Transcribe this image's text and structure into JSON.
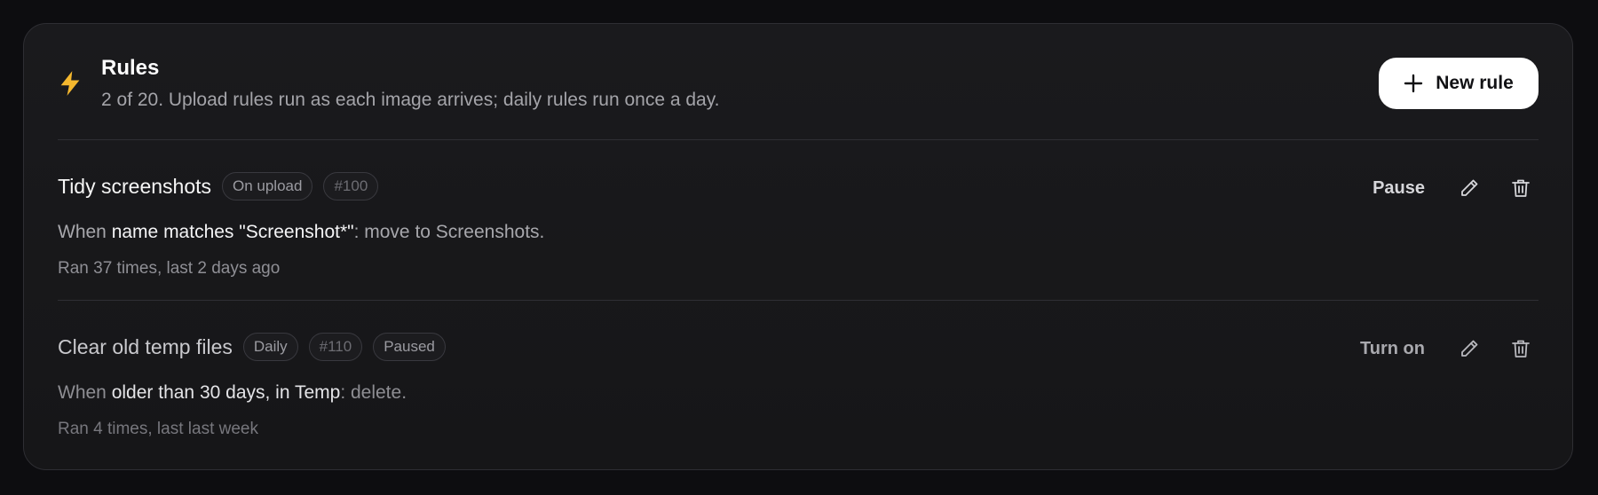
{
  "header": {
    "title": "Rules",
    "subtitle": "2 of 20. Upload rules run as each image arrives; daily rules run once a day.",
    "icon": "lightning-bolt-icon",
    "accent_color": "#f5b82e",
    "new_rule_label": "New rule"
  },
  "rules": [
    {
      "name": "Tidy screenshots",
      "trigger": "On upload",
      "number": "#100",
      "desc_prefix": "When ",
      "condition": "name matches \"Screenshot*\"",
      "desc_suffix": ": move to Screenshots.",
      "stats": "Ran 37 times, last 2 days ago",
      "toggle_label": "Pause"
    },
    {
      "name": "Clear old temp files",
      "trigger": "Daily",
      "number": "#110",
      "status": "Paused",
      "desc_prefix": "When ",
      "condition": "older than 30 days, in Temp",
      "desc_suffix": ": delete.",
      "stats": "Ran 4 times, last last week",
      "toggle_label": "Turn on"
    }
  ]
}
